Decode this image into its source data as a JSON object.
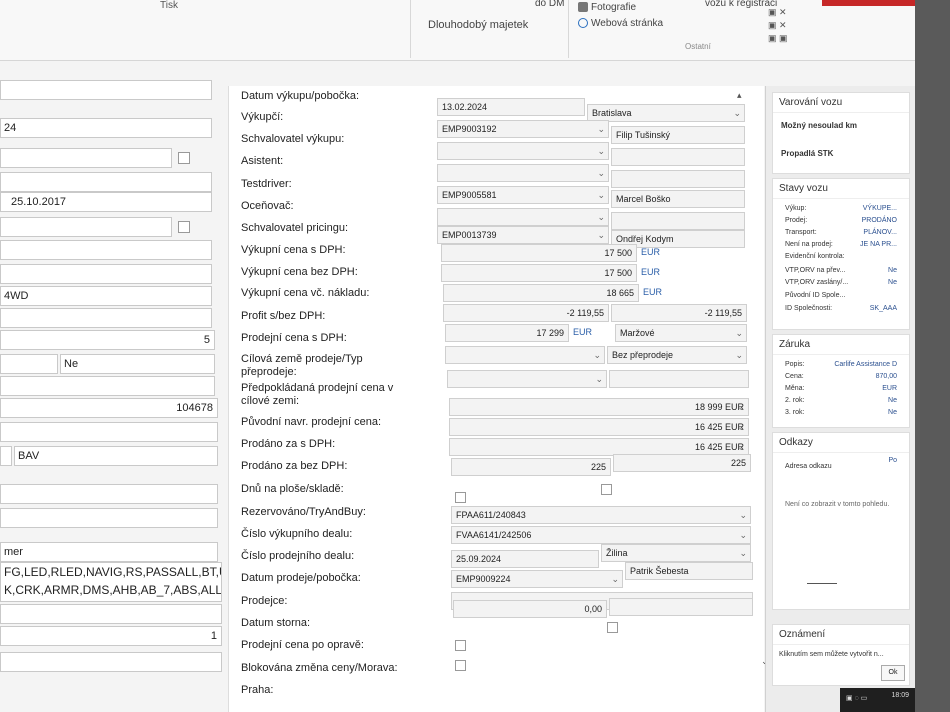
{
  "ribbon": {
    "tisk": "Tisk",
    "dm": "do DM",
    "registrace": "vozu k registraci",
    "dlouhodoby": "Dlouhodobý majetek",
    "fotografie": "Fotografie",
    "webova": "Webová stránka",
    "ostatni": "Ostatní"
  },
  "left": {
    "rows": [
      "",
      "24",
      "",
      "25.10.2017",
      "",
      "",
      "",
      "4WD",
      "",
      "5",
      "Ne",
      "",
      "104678",
      "",
      "BAV",
      "",
      "",
      "",
      "mer",
      "FG,LED,RLED,NAVIG,RS,PASSALL,BT,U",
      "K,CRK,ARMR,DMS,AHB,AB_7,ABS,ALL_",
      "",
      "1"
    ]
  },
  "form": {
    "labels": [
      "Datum výkupu/pobočka:",
      "Výkupčí:",
      "Schvalovatel výkupu:",
      "Asistent:",
      "Testdriver:",
      "Oceňovač:",
      "Schvalovatel pricingu:",
      "Výkupní cena s DPH:",
      "Výkupní cena bez DPH:",
      "Výkupní cena vč. nákladu:",
      "Profit s/bez DPH:",
      "Prodejní cena s DPH:",
      "Cílová země prodeje/Typ přeprodeje:",
      "Předpokládaná prodejní cena v cílové zemi:",
      "Původní navr. prodejní cena:",
      "Prodáno za s DPH:",
      "Prodáno za bez DPH:",
      "Dnů na ploše/skladě:",
      "Rezervováno/TryAndBuy:",
      "Číslo výkupního dealu:",
      "Číslo prodejního dealu:",
      "Datum prodeje/pobočka:",
      "Prodejce:",
      "Datum storna:",
      "Prodejní cena po opravě:",
      "Blokována změna ceny/Morava:",
      "Praha:"
    ],
    "datum_vykupu": "13.02.2024",
    "pobocka": "Bratislava",
    "vykupci_code": "EMP9003192",
    "vykupci_name": "Filip Tušinský",
    "testdriver_code": "EMP9005581",
    "testdriver_name": "Marcel Boško",
    "pricing_code": "EMP0013739",
    "pricing_name": "Ondřej Kodym",
    "cena_s_dph": "17 500",
    "cena_bez_dph": "17 500",
    "cena_naklad": "18 665",
    "eur": "EUR",
    "profit1": "-2 119,55",
    "profit2": "-2 119,55",
    "prodejni_s_dph": "17 299",
    "marzove": "Maržové",
    "bez_preprodeje": "Bez přeprodeje",
    "puvodni": "18 999",
    "prodano_s": "16 425",
    "prodano_bez": "16 425",
    "dnu1": "225",
    "dnu2": "225",
    "deal_vykup": "FPAA611/240843",
    "deal_prodej": "FVAA6141/242506",
    "datum_prodeje": "25.09.2024",
    "pobocka_prodeje": "Žilina",
    "prodejce_code": "EMP9009224",
    "prodejce_name": "Patrik Šebesta",
    "storno": "0,00"
  },
  "right": {
    "varovani": "Varování vozu",
    "nesoulad": "Možný nesoulad km",
    "stk": "Propadlá STK",
    "stavy": "Stavy vozu",
    "stavy_rows": [
      [
        "Výkup:",
        "VÝKUPE..."
      ],
      [
        "Prodej:",
        "PRODÁNO"
      ],
      [
        "Transport:",
        "PLÁNOV..."
      ],
      [
        "Není na prodej:",
        "JE NA PR..."
      ],
      [
        "Evidenční kontrola:",
        ""
      ],
      [
        "VTP,ORV na přev...",
        "Ne"
      ],
      [
        "VTP,ORV zaslány/...",
        "Ne"
      ],
      [
        "Původní ID Spole...",
        ""
      ],
      [
        "ID Společnosti:",
        "SK_AAA"
      ]
    ],
    "zaruka": "Záruka",
    "zaruka_rows": [
      [
        "Popis:",
        "Carlife Assistance D"
      ],
      [
        "Cena:",
        "870,00"
      ],
      [
        "Měna:",
        "EUR"
      ],
      [
        "2. rok:",
        "Ne"
      ],
      [
        "3. rok:",
        "Ne"
      ]
    ],
    "odkazy": "Odkazy",
    "adresa": "Adresa odkazu",
    "po": "Po",
    "nic": "Není co zobrazit v tomto pohledu.",
    "oznameni": "Oznámení",
    "klik": "Kliknutím sem můžete vytvořit n...",
    "ok": "Ok"
  },
  "taskbar": {
    "time": "18:09"
  }
}
